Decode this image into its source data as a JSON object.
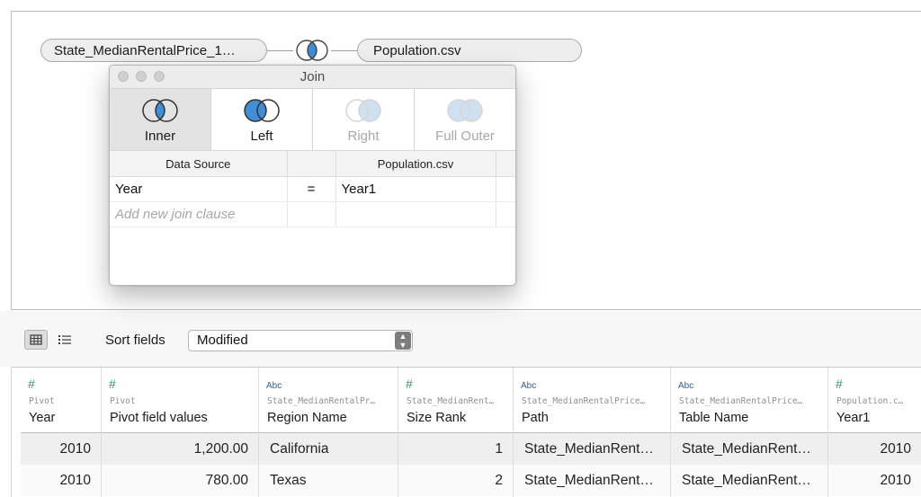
{
  "join_canvas": {
    "left_table": "State_MedianRentalPrice_1…",
    "right_table": "Population.csv",
    "join_type_icon": "left-join-icon"
  },
  "join_dialog": {
    "title": "Join",
    "types": [
      {
        "label": "Inner",
        "icon": "inner-join-icon",
        "state": "selected"
      },
      {
        "label": "Left",
        "icon": "left-join-icon",
        "state": "enabled"
      },
      {
        "label": "Right",
        "icon": "right-join-icon",
        "state": "disabled"
      },
      {
        "label": "Full Outer",
        "icon": "full-outer-join-icon",
        "state": "disabled"
      }
    ],
    "table_headers": {
      "left": "Data Source",
      "right": "Population.csv"
    },
    "clauses": [
      {
        "left": "Year",
        "operator": "=",
        "right": "Year1"
      }
    ],
    "add_clause_placeholder": "Add new join clause",
    "accent_color": "#3f8ed6"
  },
  "toolbar": {
    "grid_view_icon": "grid-view-icon",
    "list_view_icon": "list-view-icon",
    "sort_label": "Sort fields",
    "sort_value": "Modified"
  },
  "data_grid": {
    "columns": [
      {
        "type_icon": "#",
        "source": "Pivot",
        "name": "Year"
      },
      {
        "type_icon": "#",
        "source": "Pivot",
        "name": "Pivot field values"
      },
      {
        "type_icon": "Abc",
        "source": "State_MedianRentalPr…",
        "name": "Region Name"
      },
      {
        "type_icon": "#",
        "source": "State_MedianRent…",
        "name": "Size Rank"
      },
      {
        "type_icon": "Abc",
        "source": "State_MedianRentalPrice…",
        "name": "Path"
      },
      {
        "type_icon": "Abc",
        "source": "State_MedianRentalPrice…",
        "name": "Table Name"
      },
      {
        "type_icon": "#",
        "source": "Population.c…",
        "name": "Year1"
      }
    ],
    "rows": [
      [
        "2010",
        "1,200.00",
        "California",
        "1",
        "State_MedianRent…",
        "State_MedianRent…",
        "2010"
      ],
      [
        "2010",
        "780.00",
        "Texas",
        "2",
        "State_MedianRent…",
        "State_MedianRent…",
        "2010"
      ]
    ]
  }
}
